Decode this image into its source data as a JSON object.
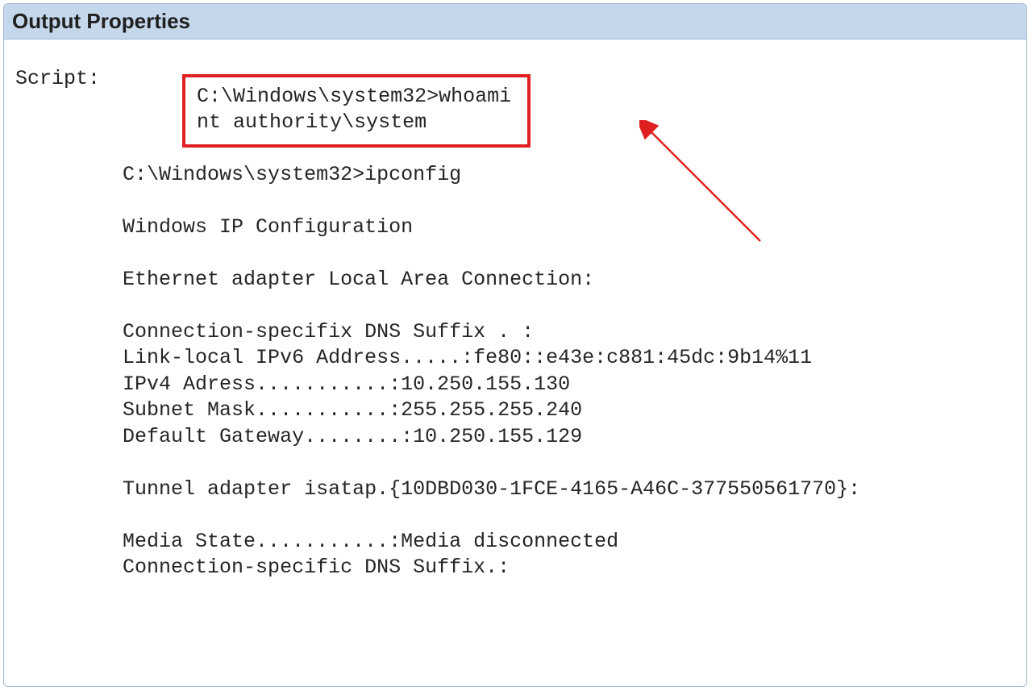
{
  "panel": {
    "title": "Output Properties"
  },
  "label": "Script:",
  "highlight": {
    "line1": "C:\\Windows\\system32>whoami",
    "line2": "nt authority\\system"
  },
  "output": {
    "line1": "C:\\Windows\\system32>ipconfig",
    "line2": "Windows IP Configuration",
    "line3": "Ethernet adapter Local Area Connection:",
    "line4": "Connection-specifix DNS Suffix . :",
    "line5": "Link-local IPv6 Address.....:fe80::e43e:c881:45dc:9b14%11",
    "line6": "IPv4 Adress...........:10.250.155.130",
    "line7": "Subnet Mask...........:255.255.255.240",
    "line8": "Default Gateway........:10.250.155.129",
    "line9": "Tunnel adapter isatap.{10DBD030-1FCE-4165-A46C-377550561770}:",
    "line10": "Media State...........:Media disconnected",
    "line11": "Connection-specific DNS Suffix.:"
  },
  "colors": {
    "highlight_border": "#e02020",
    "header_bg": "#c5d7ea",
    "panel_border": "#9fb8d0"
  }
}
